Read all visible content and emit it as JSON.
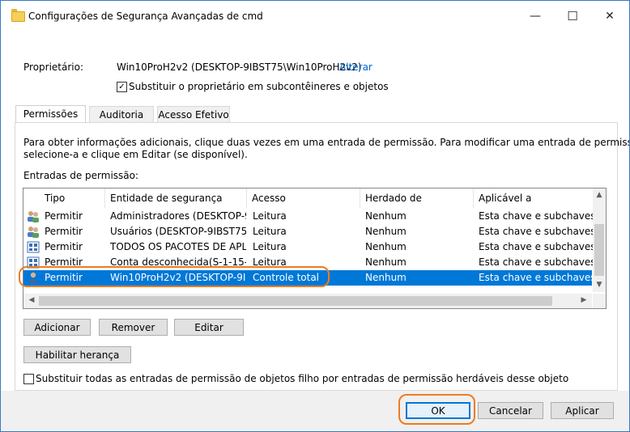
{
  "window": {
    "title": "Configurações de Segurança Avançadas de cmd",
    "minimize": "—",
    "maximize": "☐",
    "close": "✕"
  },
  "owner": {
    "label": "Proprietário:",
    "value": "Win10ProH2v2 (DESKTOP-9IBST75\\Win10ProH2v2)",
    "change_link": "Alterar",
    "replace_checkbox_label": "Substituir o proprietário em subcontêineres e objetos",
    "replace_checked": true
  },
  "tabs": [
    {
      "label": "Permissões",
      "active": true
    },
    {
      "label": "Auditoria",
      "active": false
    },
    {
      "label": "Acesso Efetivo",
      "active": false
    }
  ],
  "info_text_line1": "Para obter informações adicionais, clique duas vezes em uma entrada de permissão. Para modificar uma entrada de permissão,",
  "info_text_line2": "selecione-a e clique em Editar (se disponível).",
  "entries_label": "Entradas de permissão:",
  "columns": [
    "Tipo",
    "Entidade de segurança",
    "Acesso",
    "Herdado de",
    "Aplicável a"
  ],
  "rows": [
    {
      "icon": "users-group-icon",
      "type": "Permitir",
      "principal": "Administradores (DESKTOP-9...",
      "access": "Leitura",
      "inherited": "Nenhum",
      "applies": "Esta chave e subchaves",
      "selected": false
    },
    {
      "icon": "users-group-icon",
      "type": "Permitir",
      "principal": "Usuários (DESKTOP-9IBST75\\...",
      "access": "Leitura",
      "inherited": "Nenhum",
      "applies": "Esta chave e subchaves",
      "selected": false
    },
    {
      "icon": "app-package-icon",
      "type": "Permitir",
      "principal": "TODOS OS PACOTES DE APLI...",
      "access": "Leitura",
      "inherited": "Nenhum",
      "applies": "Esta chave e subchaves",
      "selected": false
    },
    {
      "icon": "app-package-icon",
      "type": "Permitir",
      "principal": "Conta desconhecida(S-1-15-...",
      "access": "Leitura",
      "inherited": "Nenhum",
      "applies": "Esta chave e subchaves",
      "selected": false
    },
    {
      "icon": "user-icon",
      "type": "Permitir",
      "principal": "Win10ProH2v2 (DESKTOP-9IB...",
      "access": "Controle total",
      "inherited": "Nenhum",
      "applies": "Esta chave e subchaves",
      "selected": true
    }
  ],
  "buttons": {
    "add": "Adicionar",
    "remove": "Remover",
    "edit": "Editar",
    "enable_inheritance": "Habilitar herança",
    "ok": "OK",
    "cancel": "Cancelar",
    "apply": "Aplicar"
  },
  "replace_child_label": "Substituir todas as entradas de permissão de objetos filho por entradas de permissão herdáveis desse objeto",
  "replace_child_checked": false,
  "colors": {
    "selection": "#0078d7",
    "highlight": "#ee7b22",
    "link": "#0066cc"
  }
}
